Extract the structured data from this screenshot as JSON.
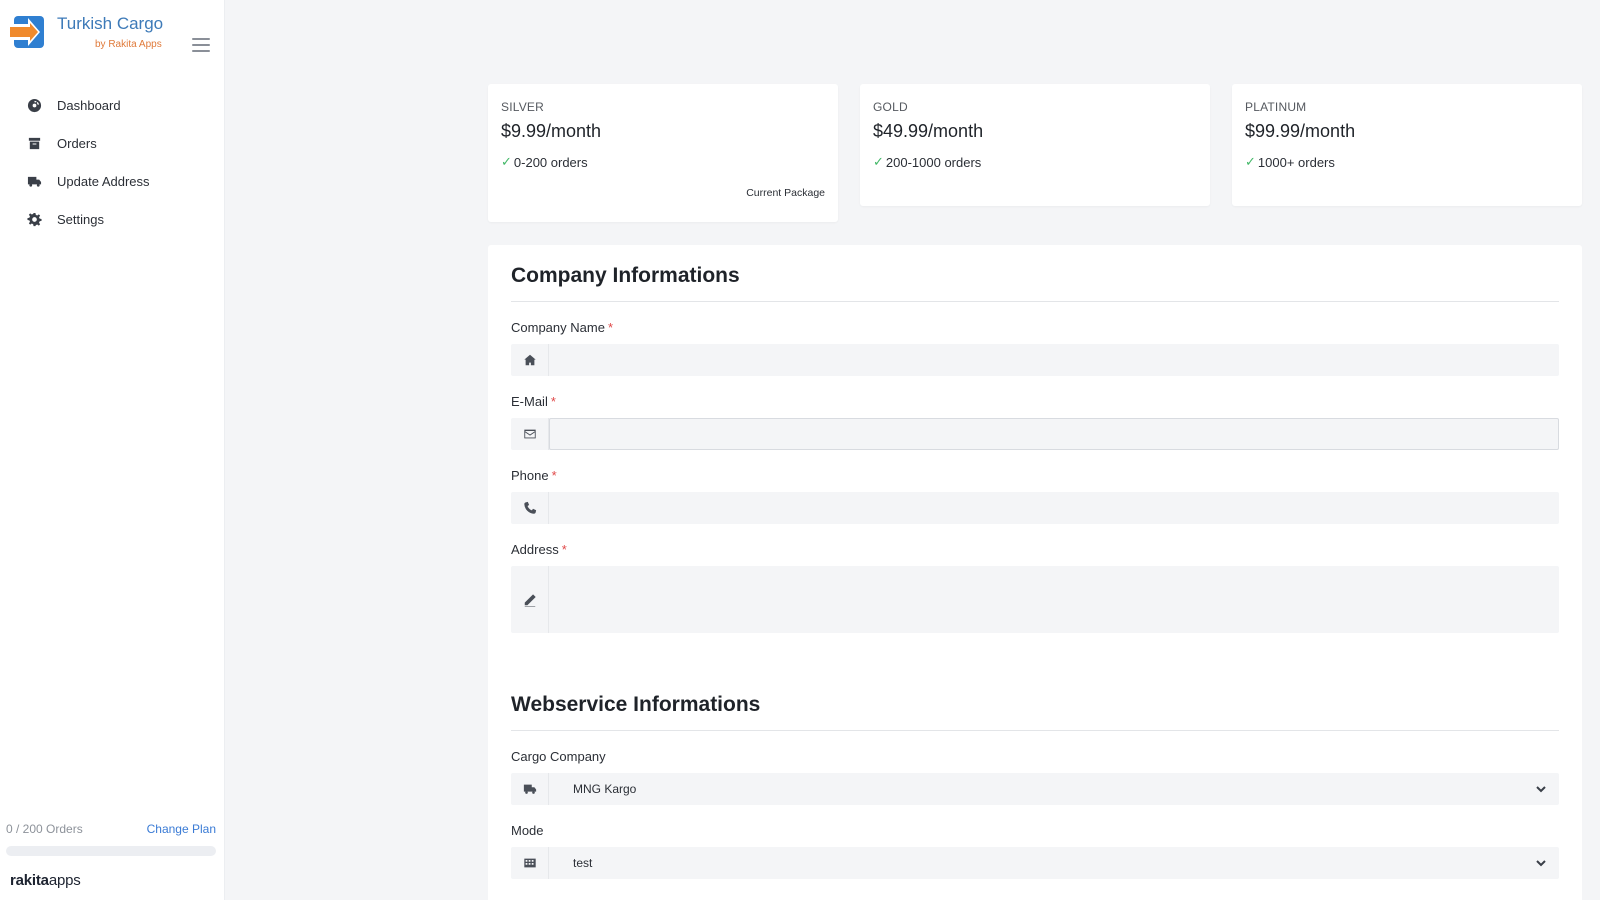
{
  "brand": {
    "title": "Turkish Cargo",
    "subtitle": "by Rakita Apps"
  },
  "sidebar": {
    "items": [
      {
        "label": "Dashboard",
        "icon": "dashboard-icon"
      },
      {
        "label": "Orders",
        "icon": "orders-icon"
      },
      {
        "label": "Update Address",
        "icon": "truck-icon"
      },
      {
        "label": "Settings",
        "icon": "gear-icon"
      }
    ],
    "usage": {
      "count_text": "0 / 200 Orders",
      "change_plan": "Change Plan",
      "progress_fraction": 0.0
    },
    "footer_logo": {
      "bold": "rakita",
      "light": "apps"
    }
  },
  "plans": [
    {
      "name": "SILVER",
      "price": "$9.99/month",
      "feature": "0-200 orders",
      "current": "Current Package"
    },
    {
      "name": "GOLD",
      "price": "$49.99/month",
      "feature": "200-1000 orders"
    },
    {
      "name": "PLATINUM",
      "price": "$99.99/month",
      "feature": "1000+ orders"
    }
  ],
  "company": {
    "title": "Company Informations",
    "fields": {
      "name": {
        "label": "Company Name",
        "value": "",
        "placeholder": ""
      },
      "email": {
        "label": "E-Mail",
        "value": "",
        "placeholder": ""
      },
      "phone": {
        "label": "Phone",
        "value": "",
        "placeholder": ""
      },
      "address": {
        "label": "Address",
        "value": "",
        "placeholder": ""
      }
    },
    "required_mark": "*"
  },
  "webservice": {
    "title": "Webservice Informations",
    "cargo_company": {
      "label": "Cargo Company",
      "value": "MNG Kargo"
    },
    "mode": {
      "label": "Mode",
      "value": "test"
    }
  },
  "colors": {
    "accent": "#3a7bd5",
    "brand_title": "#3d7ab8",
    "brand_sub": "#e07a3a",
    "required": "#e04848",
    "check": "#43b868"
  }
}
